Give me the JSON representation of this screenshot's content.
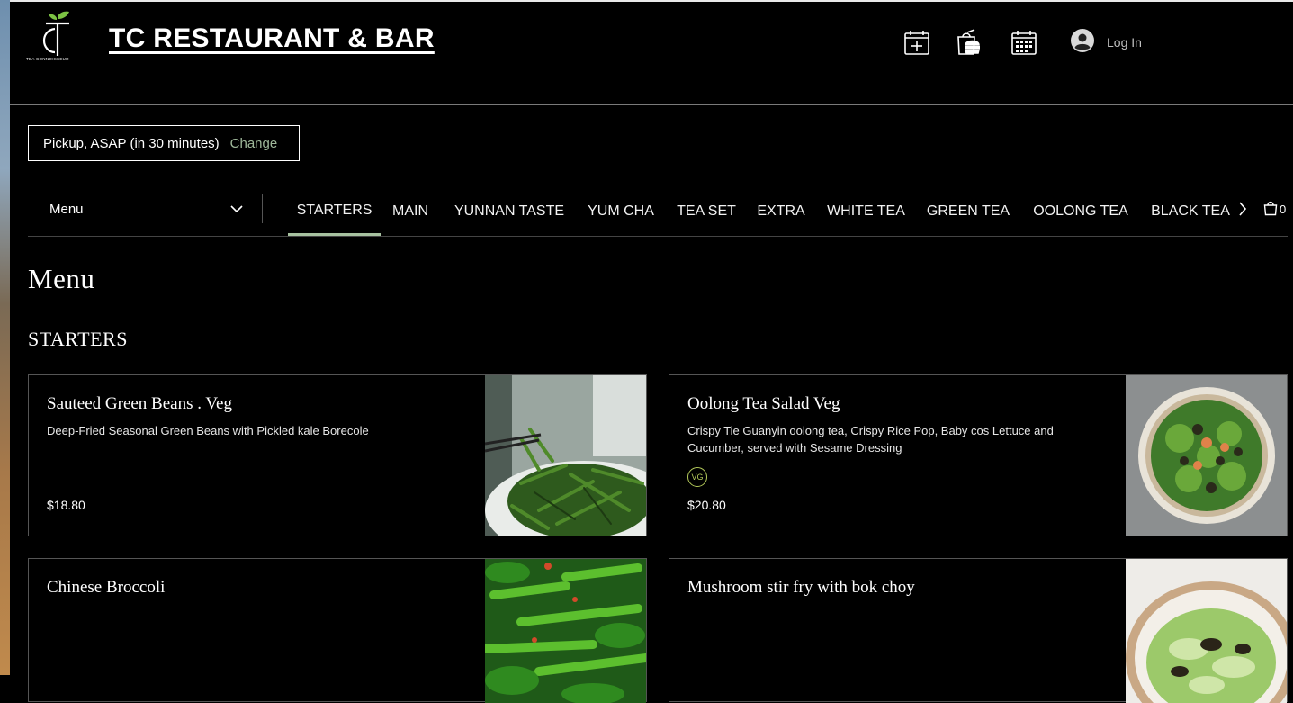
{
  "header": {
    "logo_caption": "TEA CONNOISSEUR",
    "site_title": "TC RESTAURANT & BAR",
    "icons": [
      "calendar-plus-icon",
      "takeaway-bag-icon",
      "calendar-grid-icon"
    ],
    "login_label": "Log In"
  },
  "pickup": {
    "label": "Pickup, ASAP (in 30 minutes)",
    "change_label": "Change"
  },
  "menu_selector": {
    "selected": "Menu"
  },
  "tabs": [
    {
      "label": "STARTERS",
      "active": true
    },
    {
      "label": "MAIN",
      "active": false
    },
    {
      "label": "YUNNAN TASTE",
      "active": false
    },
    {
      "label": "YUM CHA",
      "active": false
    },
    {
      "label": "TEA SET",
      "active": false
    },
    {
      "label": "EXTRA",
      "active": false
    },
    {
      "label": "WHITE TEA",
      "active": false
    },
    {
      "label": "GREEN TEA",
      "active": false
    },
    {
      "label": "OOLONG TEA",
      "active": false
    },
    {
      "label": "BLACK TEA",
      "active": false
    }
  ],
  "cart": {
    "count": "0"
  },
  "page_heading": "Menu",
  "section_heading": "STARTERS",
  "items": [
    {
      "name": "Sauteed Green Beans . Veg",
      "description": "Deep-Fried Seasonal Green Beans with Pickled kale Borecole",
      "price": "$18.80",
      "badge": ""
    },
    {
      "name": "Oolong Tea Salad Veg",
      "description": "Crispy Tie Guanyin oolong tea, Crispy Rice Pop, Baby cos Lettuce and Cucumber, served with Sesame Dressing",
      "price": "$20.80",
      "badge": "VG"
    },
    {
      "name": "Chinese Broccoli",
      "description": "",
      "price": "",
      "badge": ""
    },
    {
      "name": "Mushroom stir fry with bok choy",
      "description": "",
      "price": "",
      "badge": ""
    }
  ],
  "colors": {
    "background": "#000000",
    "active_tab_underline": "#a7c2a0",
    "change_link": "#9fb89a",
    "veg_badge": "#b3c95a"
  }
}
